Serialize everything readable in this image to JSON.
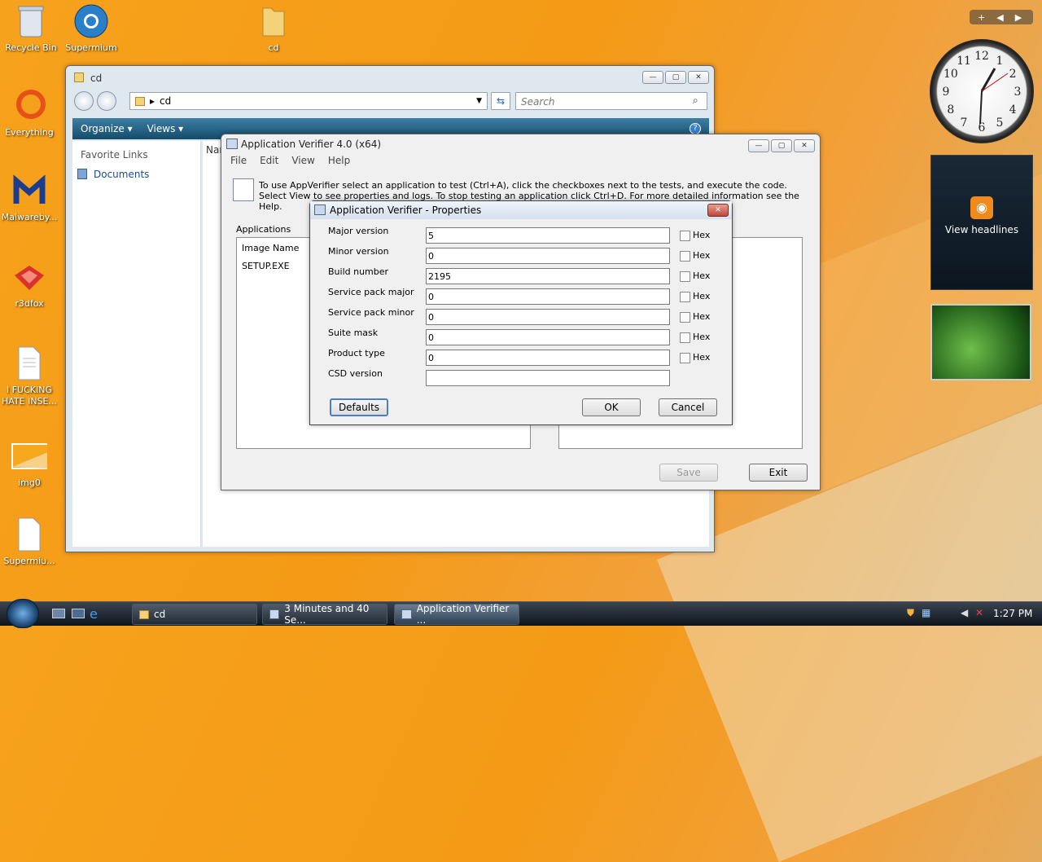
{
  "desktop": {
    "icons": [
      {
        "label": "Recycle Bin",
        "icon": "recycle-bin-icon"
      },
      {
        "label": "Supermium",
        "icon": "supermium-icon"
      },
      {
        "label": "cd",
        "icon": "folder-icon"
      },
      {
        "label": "Everything",
        "icon": "everything-icon"
      },
      {
        "label": "Malwareby...",
        "icon": "malwarebytes-icon"
      },
      {
        "label": "r3dfox",
        "icon": "r3dfox-icon"
      },
      {
        "label": "I FUCKING HATE INSE...",
        "icon": "text-file-icon"
      },
      {
        "label": "img0",
        "icon": "image-file-icon"
      },
      {
        "label": "Supermiu...",
        "icon": "file-icon"
      }
    ]
  },
  "explorer": {
    "title": "cd",
    "address": "cd",
    "search_placeholder": "Search",
    "organize_label": "Organize",
    "views_label": "Views",
    "favorite_links_label": "Favorite Links",
    "documents_label": "Documents",
    "column_name": "Nar"
  },
  "appverifier": {
    "title": "Application Verifier 4.0 (x64)",
    "menu": [
      "File",
      "Edit",
      "View",
      "Help"
    ],
    "instructions": "To use AppVerifier select an application to test (Ctrl+A), click the checkboxes next to the tests, and execute the code. Select View to see properties and logs. To stop testing an application click Ctrl+D. For more detailed information see the Help.",
    "applications_label": "Applications",
    "column_image_name": "Image Name",
    "rows": [
      "SETUP.EXE"
    ],
    "save_label": "Save",
    "exit_label": "Exit"
  },
  "properties": {
    "title": "Application Verifier - Properties",
    "fields": [
      {
        "label": "Major version",
        "value": "5",
        "hex": true
      },
      {
        "label": "Minor version",
        "value": "0",
        "hex": true
      },
      {
        "label": "Build number",
        "value": "2195",
        "hex": true
      },
      {
        "label": "Service pack major",
        "value": "0",
        "hex": true
      },
      {
        "label": "Service pack minor",
        "value": "0",
        "hex": true
      },
      {
        "label": "Suite mask",
        "value": "0",
        "hex": true
      },
      {
        "label": "Product type",
        "value": "0",
        "hex": true
      },
      {
        "label": "CSD version",
        "value": "",
        "hex": false
      }
    ],
    "hex_label": "Hex",
    "defaults_label": "Defaults",
    "ok_label": "OK",
    "cancel_label": "Cancel"
  },
  "gadgets": {
    "rss_label": "View headlines",
    "bar_add": "+",
    "clock_numbers": [
      "12",
      "1",
      "2",
      "3",
      "4",
      "5",
      "6",
      "7",
      "8",
      "9",
      "10",
      "11"
    ]
  },
  "taskbar": {
    "items": [
      {
        "label": "cd",
        "icon": "folder-icon"
      },
      {
        "label": "3 Minutes and 40 Se...",
        "icon": "appverifier-icon"
      },
      {
        "label": "Application Verifier ...",
        "icon": "appverifier-icon",
        "active": true
      }
    ],
    "clock": "1:27 PM"
  },
  "colors": {
    "accent": "#144b6b",
    "desktop": "#f49a16"
  }
}
